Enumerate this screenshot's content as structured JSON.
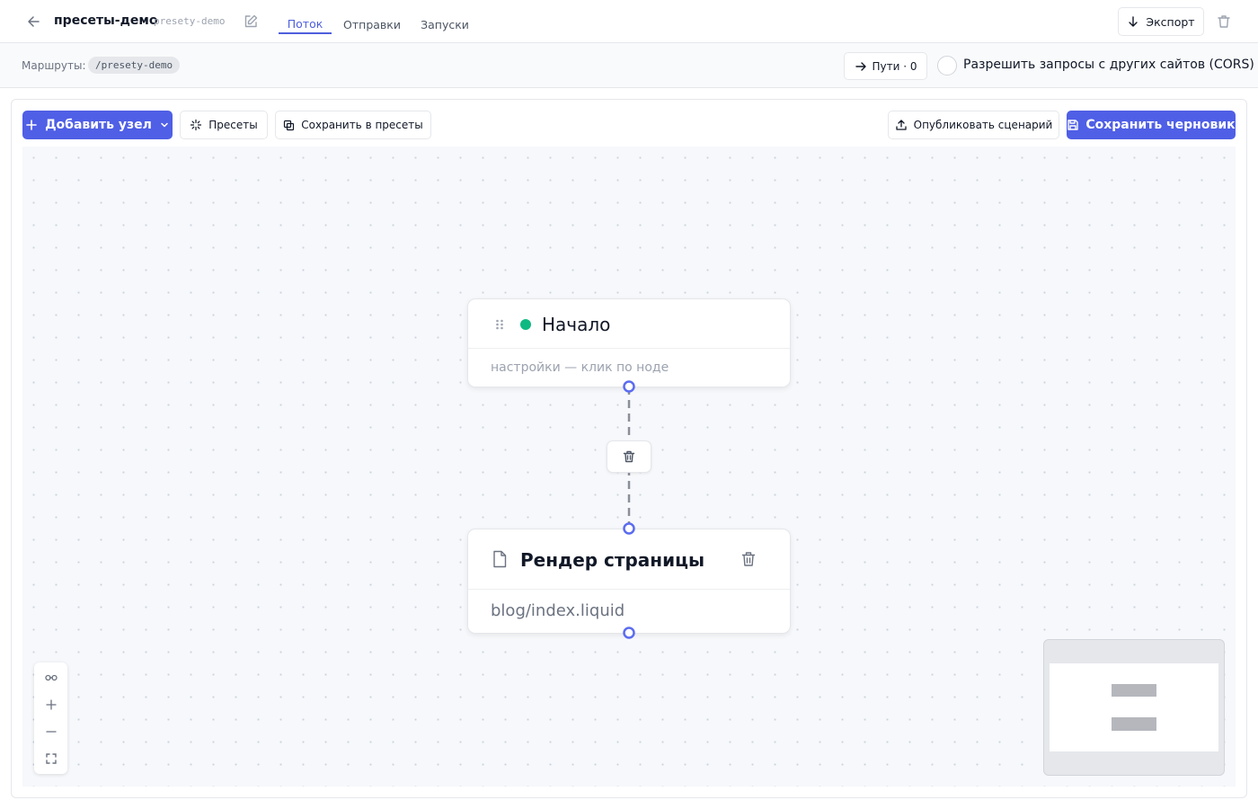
{
  "header": {
    "project_title": "пресеты-демо",
    "project_slug": "presety-demo",
    "tabs": [
      {
        "label": "Поток",
        "active": true
      },
      {
        "label": "Отправки",
        "active": false
      },
      {
        "label": "Запуски",
        "active": false
      }
    ],
    "export_label": "Экспорт"
  },
  "routes": {
    "label": "Маршруты:",
    "path": "/presety-demo",
    "paths_button": "Пути · 0",
    "cors_label": "Разрешить запросы с других сайтов (CORS)",
    "cors_enabled": false
  },
  "toolbar": {
    "add_node": "Добавить узел",
    "presets": "Пресеты",
    "save_to_presets": "Сохранить в пресеты",
    "publish": "Опубликовать сценарий",
    "save_draft": "Сохранить черновик"
  },
  "nodes": {
    "start": {
      "title": "Начало",
      "subtitle": "настройки — клик по ноде",
      "status_color": "#10b981"
    },
    "render": {
      "title": "Рендер страницы",
      "subtitle": "blog/index.liquid"
    }
  },
  "colors": {
    "accent": "#4f5fe6",
    "handle": "#5b6cf0",
    "edge": "#8a8f98"
  },
  "icons": {
    "back": "arrow-left-icon",
    "edit": "edit-icon",
    "export": "arrow-down-icon",
    "trash": "trash-icon",
    "paths": "arrow-right-icon",
    "add": "plus-icon",
    "chevron": "chevron-down-icon",
    "presets": "sparkle-icon",
    "save_presets": "copy-icon",
    "publish": "upload-icon",
    "save_draft": "save-icon",
    "drag": "grip-icon",
    "file": "file-icon",
    "fit": "link-icon",
    "zoom_in": "plus-icon",
    "zoom_out": "minus-icon",
    "fullscreen": "fullscreen-icon"
  }
}
